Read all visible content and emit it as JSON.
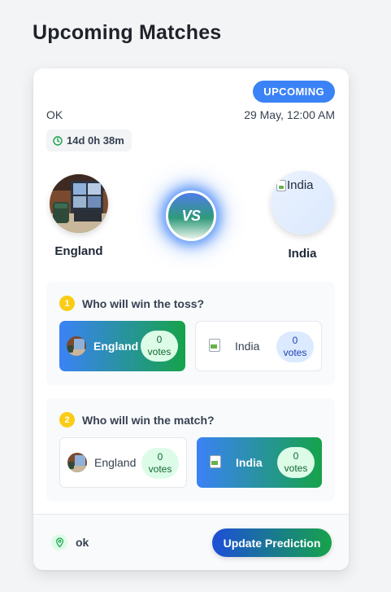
{
  "page": {
    "title": "Upcoming Matches"
  },
  "match": {
    "status": "UPCOMING",
    "venue": "OK",
    "datetime": "29 May, 12:00 AM",
    "countdown": "14d 0h 38m",
    "vs_label": "VS",
    "home_team": {
      "name": "England",
      "logo_icon": "photo-thumbnail"
    },
    "away_team": {
      "name": "India",
      "logo_alt": "India",
      "logo_icon": "broken-image-icon"
    }
  },
  "questions": [
    {
      "number": "1",
      "text": "Who will win the toss?",
      "options": [
        {
          "label": "England",
          "count": "0",
          "unit": "votes",
          "selected": true
        },
        {
          "label": "India",
          "count": "0",
          "unit": "votes",
          "selected": false
        }
      ]
    },
    {
      "number": "2",
      "text": "Who will win the match?",
      "options": [
        {
          "label": "England",
          "count": "0",
          "unit": "votes",
          "selected": false
        },
        {
          "label": "India",
          "count": "0",
          "unit": "votes",
          "selected": true
        }
      ]
    }
  ],
  "footer": {
    "venue": "ok",
    "button_label": "Update Prediction"
  },
  "colors": {
    "accent_blue": "#3b82f6",
    "accent_green": "#16a34a",
    "badge_yellow": "#facc15"
  }
}
